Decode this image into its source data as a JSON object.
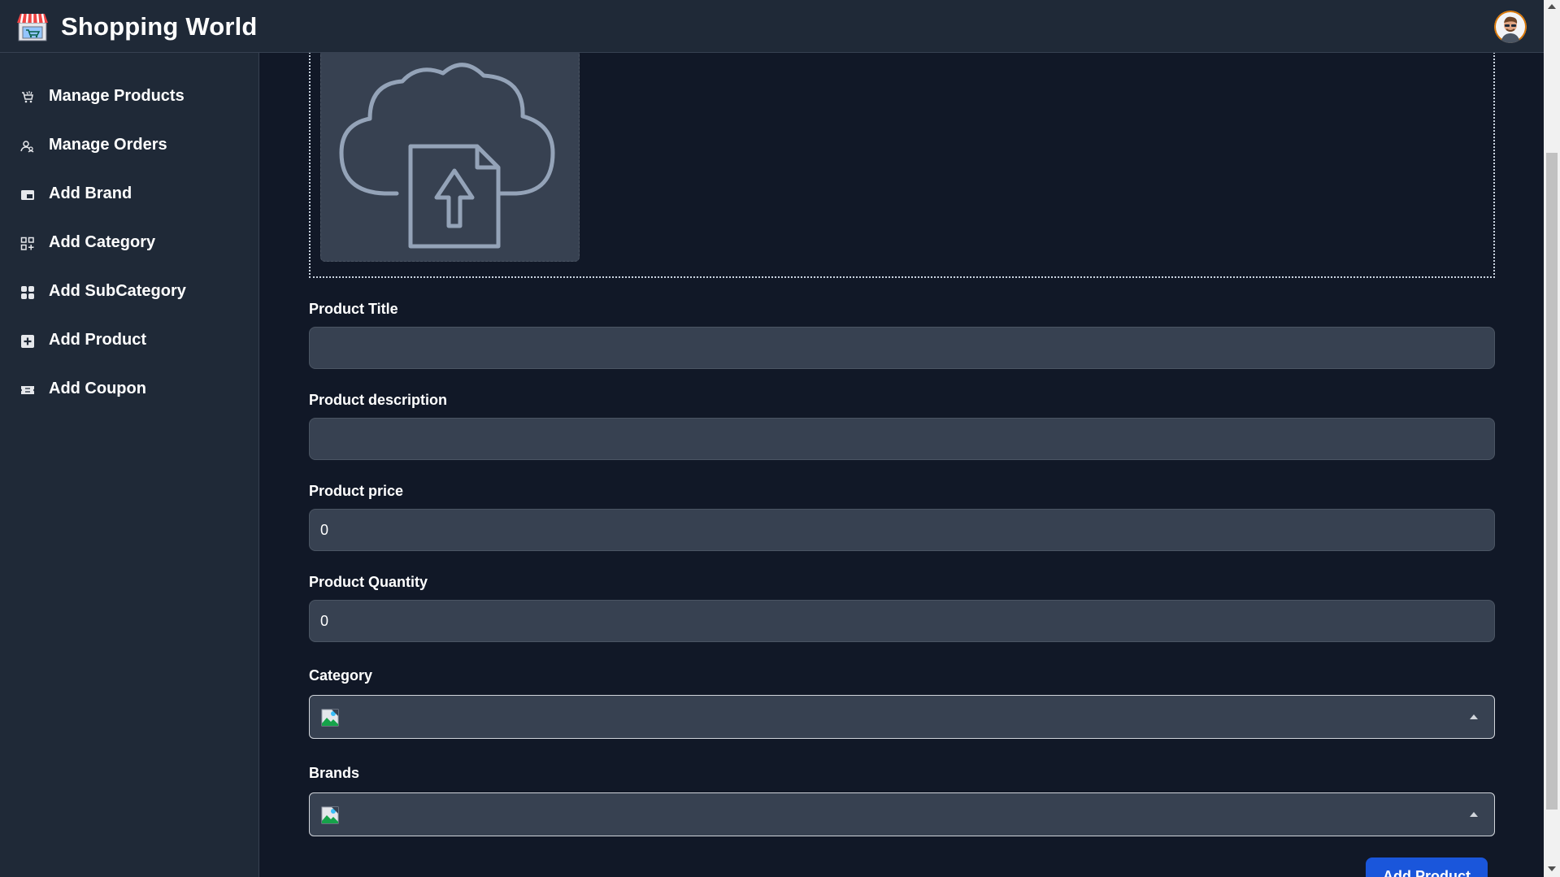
{
  "header": {
    "app_title": "Shopping World",
    "logo_icon": "shop-icon",
    "avatar_icon": "user-avatar"
  },
  "sidebar": {
    "items": [
      {
        "label": "Manage Products",
        "icon": "cart-icon"
      },
      {
        "label": "Manage Orders",
        "icon": "users-icon"
      },
      {
        "label": "Add Brand",
        "icon": "brand-card-icon"
      },
      {
        "label": "Add Category",
        "icon": "grid-plus-icon"
      },
      {
        "label": "Add SubCategory",
        "icon": "grid-icon"
      },
      {
        "label": "Add Product",
        "icon": "plus-square-icon"
      },
      {
        "label": "Add Coupon",
        "icon": "ticket-icon"
      }
    ]
  },
  "form": {
    "upload_icon": "cloud-upload-icon",
    "title_label": "Product Title",
    "title_value": "",
    "description_label": "Product description",
    "description_value": "",
    "price_label": "Product price",
    "price_value": "0",
    "quantity_label": "Product Quantity",
    "quantity_value": "0",
    "category_label": "Category",
    "brands_label": "Brands",
    "submit_label": "Add Product"
  },
  "colors": {
    "background": "#111827",
    "surface": "#1f2937",
    "input": "#374151",
    "primary": "#1a56db"
  }
}
